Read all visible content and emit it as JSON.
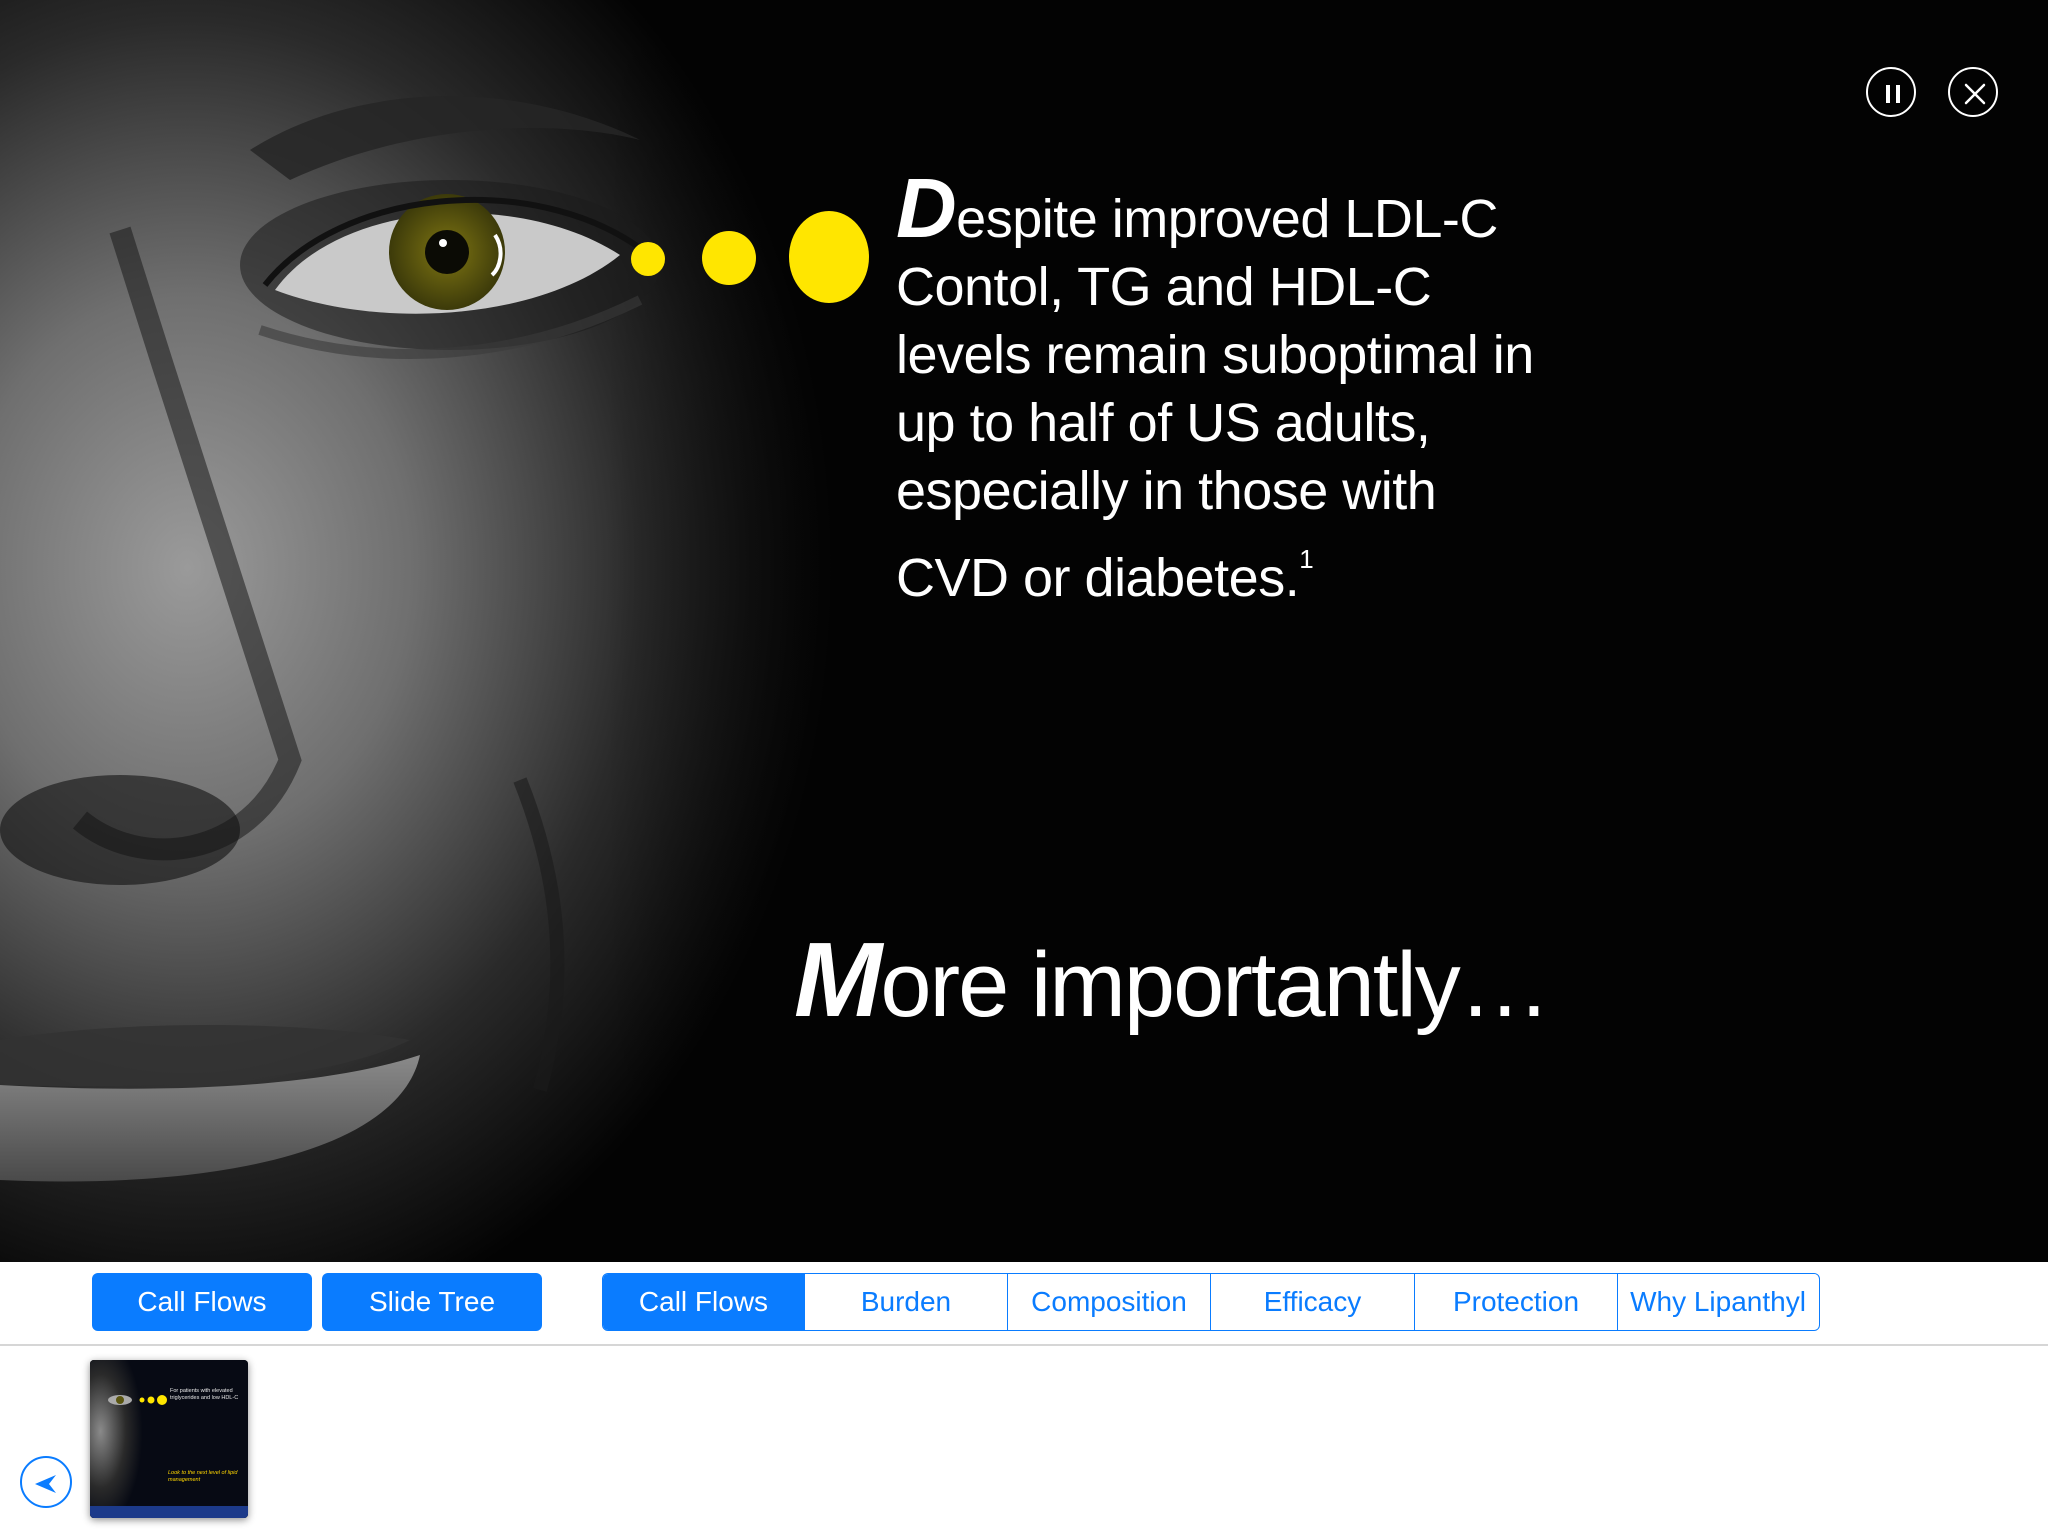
{
  "slide": {
    "headline_initial": "D",
    "headline_rest": "espite improved LDL-C Contol, TG and HDL-C levels remain suboptimal in up to half of US adults, especially in those with CVD or diabetes.",
    "headline_ref": "1",
    "subhead_initial": "M",
    "subhead_rest": "ore importantly…",
    "accent_color": "#ffe600",
    "controls": {
      "pause_icon": "pause-icon",
      "close_icon": "close-icon"
    }
  },
  "navbar": {
    "left_buttons": [
      {
        "label": "Call Flows"
      },
      {
        "label": "Slide Tree"
      }
    ],
    "segments": [
      {
        "label": "Call Flows",
        "active": true
      },
      {
        "label": "Burden",
        "active": false
      },
      {
        "label": "Composition",
        "active": false
      },
      {
        "label": "Efficacy",
        "active": false
      },
      {
        "label": "Protection",
        "active": false
      },
      {
        "label": "Why Lipanthyl",
        "active": false
      }
    ],
    "accent_color": "#0a7cff"
  },
  "tray": {
    "back_icon": "back-arrow-icon",
    "thumbnail": {
      "text": "For patients with elevated triglycerides and low HDL-C",
      "tagline": "Look to the next level of lipid management"
    }
  }
}
